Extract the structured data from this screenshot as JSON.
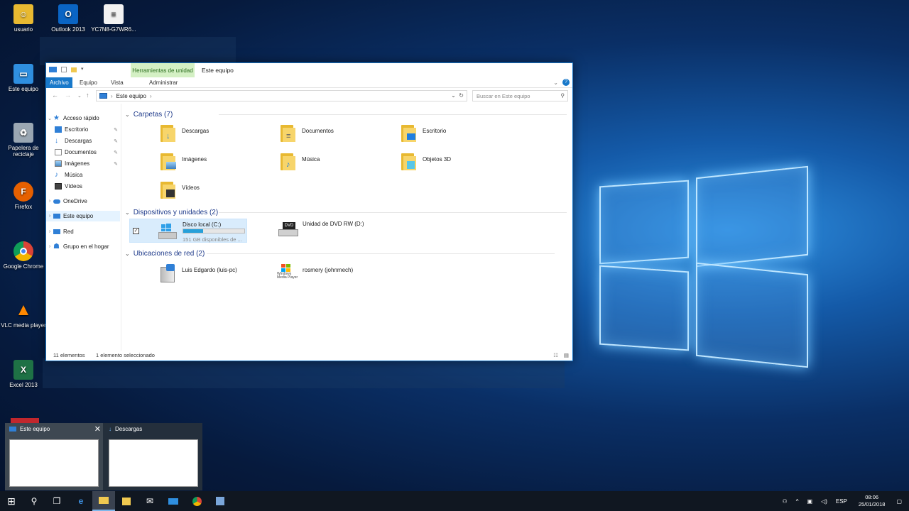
{
  "desktop": {
    "icons": [
      {
        "label": "usuario",
        "icon": "user-folder-icon"
      },
      {
        "label": "Outlook 2013",
        "icon": "outlook-icon"
      },
      {
        "label": "YC7N8-G7WR6...",
        "icon": "text-file-icon"
      },
      {
        "label": "Este equipo",
        "icon": "computer-icon"
      },
      {
        "label": "Papelera de reciclaje",
        "icon": "recycle-bin-icon"
      },
      {
        "label": "Firefox",
        "icon": "firefox-icon"
      },
      {
        "label": "Google Chrome",
        "icon": "chrome-icon"
      },
      {
        "label": "VLC media player",
        "icon": "vlc-icon"
      },
      {
        "label": "Excel 2013",
        "icon": "excel-icon"
      }
    ]
  },
  "window": {
    "context_tab": "Herramientas de unidad",
    "title": "Este equipo",
    "ribbon_tabs": [
      "Archivo",
      "Equipo",
      "Vista"
    ],
    "context_sub_tab": "Administrar",
    "address_path": "Este equipo",
    "search_placeholder": "Buscar en Este equipo",
    "nav": {
      "quick_access": "Acceso rápido",
      "quick_items": [
        "Escritorio",
        "Descargas",
        "Documentos",
        "Imágenes",
        "Música",
        "Vídeos"
      ],
      "onedrive": "OneDrive",
      "this_pc": "Este equipo",
      "network": "Red",
      "homegroup": "Grupo en el hogar"
    },
    "groups": {
      "folders": "Carpetas (7)",
      "devices": "Dispositivos y unidades (2)",
      "network": "Ubicaciones de red (2)"
    },
    "folders": [
      "Descargas",
      "Documentos",
      "Escritorio",
      "Imágenes",
      "Música",
      "Objetos 3D",
      "Vídeos"
    ],
    "drives": {
      "c_name": "Disco local (C:)",
      "c_free": "151 GB disponibles de ...",
      "c_used_fraction": 0.32,
      "dvd_name": "Unidad de DVD RW (D:)",
      "dvd_badge": "DVD"
    },
    "network_locations": [
      "Luis Edgardo (luis-pc)",
      "rosmery (johnmech)"
    ],
    "wmp_logo": "Windows Media Player",
    "status": {
      "count": "11 elementos",
      "selected": "1 elemento seleccionado"
    }
  },
  "thumbnails": [
    {
      "title": "Este equipo"
    },
    {
      "title": "Descargas"
    }
  ],
  "tray": {
    "language": "ESP",
    "time": "08:06",
    "date": "25/01/2018"
  }
}
